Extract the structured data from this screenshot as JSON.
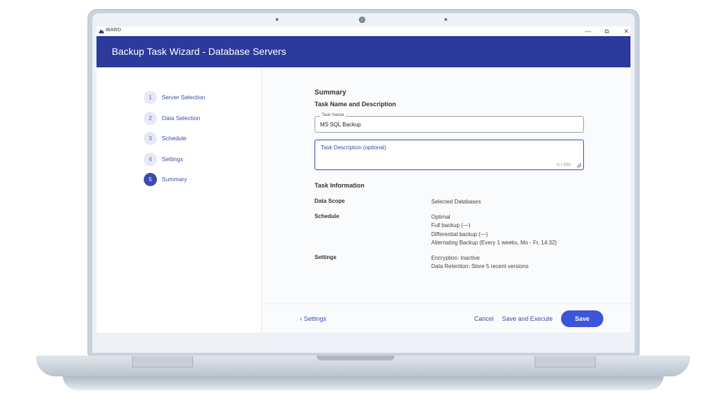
{
  "app": {
    "name": "IBARD",
    "window_title": "Backup Task Wizard - Database Servers"
  },
  "window_controls": {
    "minimize": "—",
    "restore": "⧉",
    "close": "✕"
  },
  "steps": [
    {
      "number": "1",
      "label": "Server Selection"
    },
    {
      "number": "2",
      "label": "Data Selection"
    },
    {
      "number": "3",
      "label": "Schedule"
    },
    {
      "number": "4",
      "label": "Settings"
    },
    {
      "number": "5",
      "label": "Summary",
      "active": true
    }
  ],
  "summary": {
    "heading": "Summary",
    "subheading": "Task Name and Description",
    "task_name": {
      "label": "Task Name",
      "value": "MS SQL Backup"
    },
    "task_description": {
      "placeholder": "Task Description (optional)",
      "counter": "0 / 200"
    },
    "info_heading": "Task Information",
    "info": {
      "data_scope": {
        "label": "Data Scope",
        "value": "Selected Databases"
      },
      "schedule": {
        "label": "Schedule",
        "lines": [
          "Optimal",
          "Full backup (—)",
          "Differential backup (—)",
          "Alternating Backup (Every 1 weeks, Mo - Fr, 14:32)"
        ]
      },
      "settings": {
        "label": "Settings",
        "lines": [
          "Encryption: Inactive",
          "Data Retention: Store 5 recent versions"
        ]
      }
    }
  },
  "footer": {
    "back_label": "‹  Settings",
    "cancel_label": "Cancel",
    "save_execute_label": "Save and Execute",
    "save_label": "Save"
  },
  "colors": {
    "header": "#2b3a9c",
    "accent": "#3b4ab0",
    "save_button": "#3d55d8"
  }
}
